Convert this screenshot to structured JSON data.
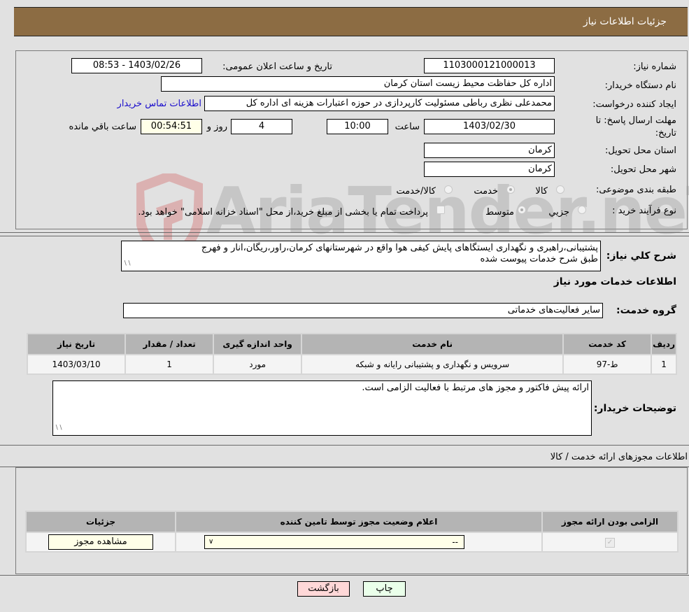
{
  "header": {
    "title": "جزئیات اطلاعات نیاز"
  },
  "details": {
    "need_number_label": "شماره نیاز:",
    "need_number": "1103000121000013",
    "announce_label": "تاریخ و ساعت اعلان عمومی:",
    "announce_value": "1403/02/26 - 08:53",
    "buyer_org_label": "نام دستگاه خریدار:",
    "buyer_org": "اداره کل حفاظت محیط زیست استان کرمان",
    "requester_label": "ایجاد کننده درخواست:",
    "requester": "محمدعلی نظری رباطی مسئولیت کارپردازی در حوزه اعتبارات هزینه ای اداره کل",
    "contact_link": "اطلاعات تماس خریدار",
    "deadline_label_1": "مهلت ارسال پاسخ: تا",
    "deadline_label_2": "تاریخ:",
    "deadline_date": "1403/02/30",
    "time_label": "ساعت",
    "deadline_time": "10:00",
    "days_value": "4",
    "days_label": "روز و",
    "remaining_time": "00:54:51",
    "remaining_label": "ساعت باقي مانده",
    "province_label": "استان محل تحویل:",
    "province": "کرمان",
    "city_label": "شهر محل تحویل:",
    "city": "کرمان",
    "category_label": "طبقه بندی موضوعی:",
    "category_options": [
      "کالا",
      "خدمت",
      "کالا/خدمت"
    ],
    "category_selected": "خدمت",
    "process_label": "نوع فرآیند خرید :",
    "process_options": [
      "جزيي",
      "متوسط"
    ],
    "process_selected": "متوسط",
    "treasury_note": "پرداخت تمام یا بخشی از مبلغ خرید،از محل \"اسناد خزانه اسلامی\" خواهد بود.",
    "treasury_checked": false
  },
  "description": {
    "label": "شرح كلي نياز:",
    "text_line1": "پشتیبانی،راهبری و نگهداری ایستگاهای پایش کیفی هوا واقع در شهرستانهای کرمان،راور،ریگان،انار و فهرج",
    "text_line2": "طبق شرح خدمات پیوست شده"
  },
  "services": {
    "section_title": "اطلاعات خدمات مورد نیاز",
    "group_label": "گروه خدمت:",
    "group_value": "سایر فعالیت‌های خدماتی",
    "columns": [
      "ردیف",
      "کد خدمت",
      "نام خدمت",
      "واحد اندازه گیری",
      "تعداد / مقدار",
      "تاریخ نیاز"
    ],
    "rows": [
      {
        "row": "1",
        "code": "ط-97",
        "name": "سرویس و نگهداری و پشتیبانی رایانه و شبکه",
        "unit": "مورد",
        "qty": "1",
        "date": "1403/03/10"
      }
    ]
  },
  "buyer_notes": {
    "label": "توضیحات خریدار:",
    "text": "ارائه پیش فاکتور و مجوز های مرتبط با فعالیت الزامی است."
  },
  "permits": {
    "section_title": "اطلاعات مجوزهای ارائه خدمت / کالا",
    "columns": [
      "الزامی بودن ارائه مجوز",
      "اعلام وضعیت مجوز توسط تامین کننده",
      "جزئیات"
    ],
    "rows": [
      {
        "required": true,
        "status_value": "--",
        "details_button": "مشاهده مجوز"
      }
    ]
  },
  "footer": {
    "print_button": "چاپ",
    "back_button": "بازگشت"
  },
  "watermark": "AriaTender.neT"
}
